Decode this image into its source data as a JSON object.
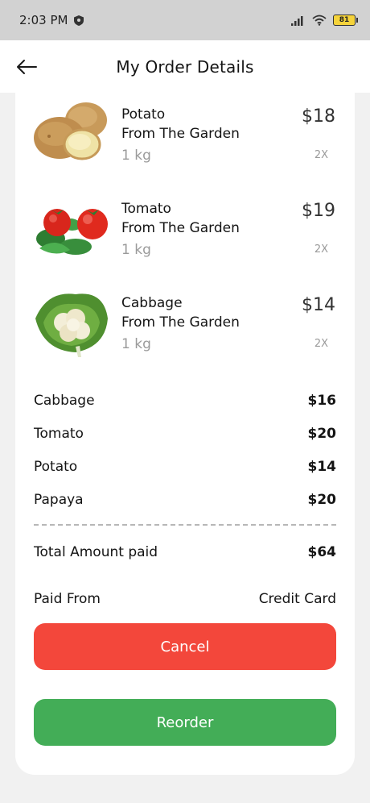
{
  "status_bar": {
    "time": "2:03 PM",
    "battery": "81"
  },
  "header": {
    "title": "My Order Details"
  },
  "products": [
    {
      "name_line1": "Potato",
      "name_line2": "From The Garden",
      "weight": "1 kg",
      "price": "$18",
      "qty": "2X",
      "icon": "potato-icon"
    },
    {
      "name_line1": "Tomato",
      "name_line2": "From The Garden",
      "weight": "1 kg",
      "price": "$19",
      "qty": "2X",
      "icon": "tomato-icon"
    },
    {
      "name_line1": "Cabbage",
      "name_line2": "From The Garden",
      "weight": "1 kg",
      "price": "$14",
      "qty": "2X",
      "icon": "cabbage-icon"
    }
  ],
  "summary": {
    "items": [
      {
        "label": "Cabbage",
        "amount": "$16"
      },
      {
        "label": "Tomato",
        "amount": "$20"
      },
      {
        "label": "Potato",
        "amount": "$14"
      },
      {
        "label": "Papaya",
        "amount": "$20"
      }
    ],
    "total_label": "Total Amount paid",
    "total_amount": "$64",
    "paid_from_label": "Paid From",
    "paid_from_value": "Credit Card"
  },
  "actions": {
    "cancel_label": "Cancel",
    "reorder_label": "Reorder"
  },
  "colors": {
    "cancel": "#f3473b",
    "reorder": "#43ad57",
    "status_bar": "#d2d2d2"
  }
}
